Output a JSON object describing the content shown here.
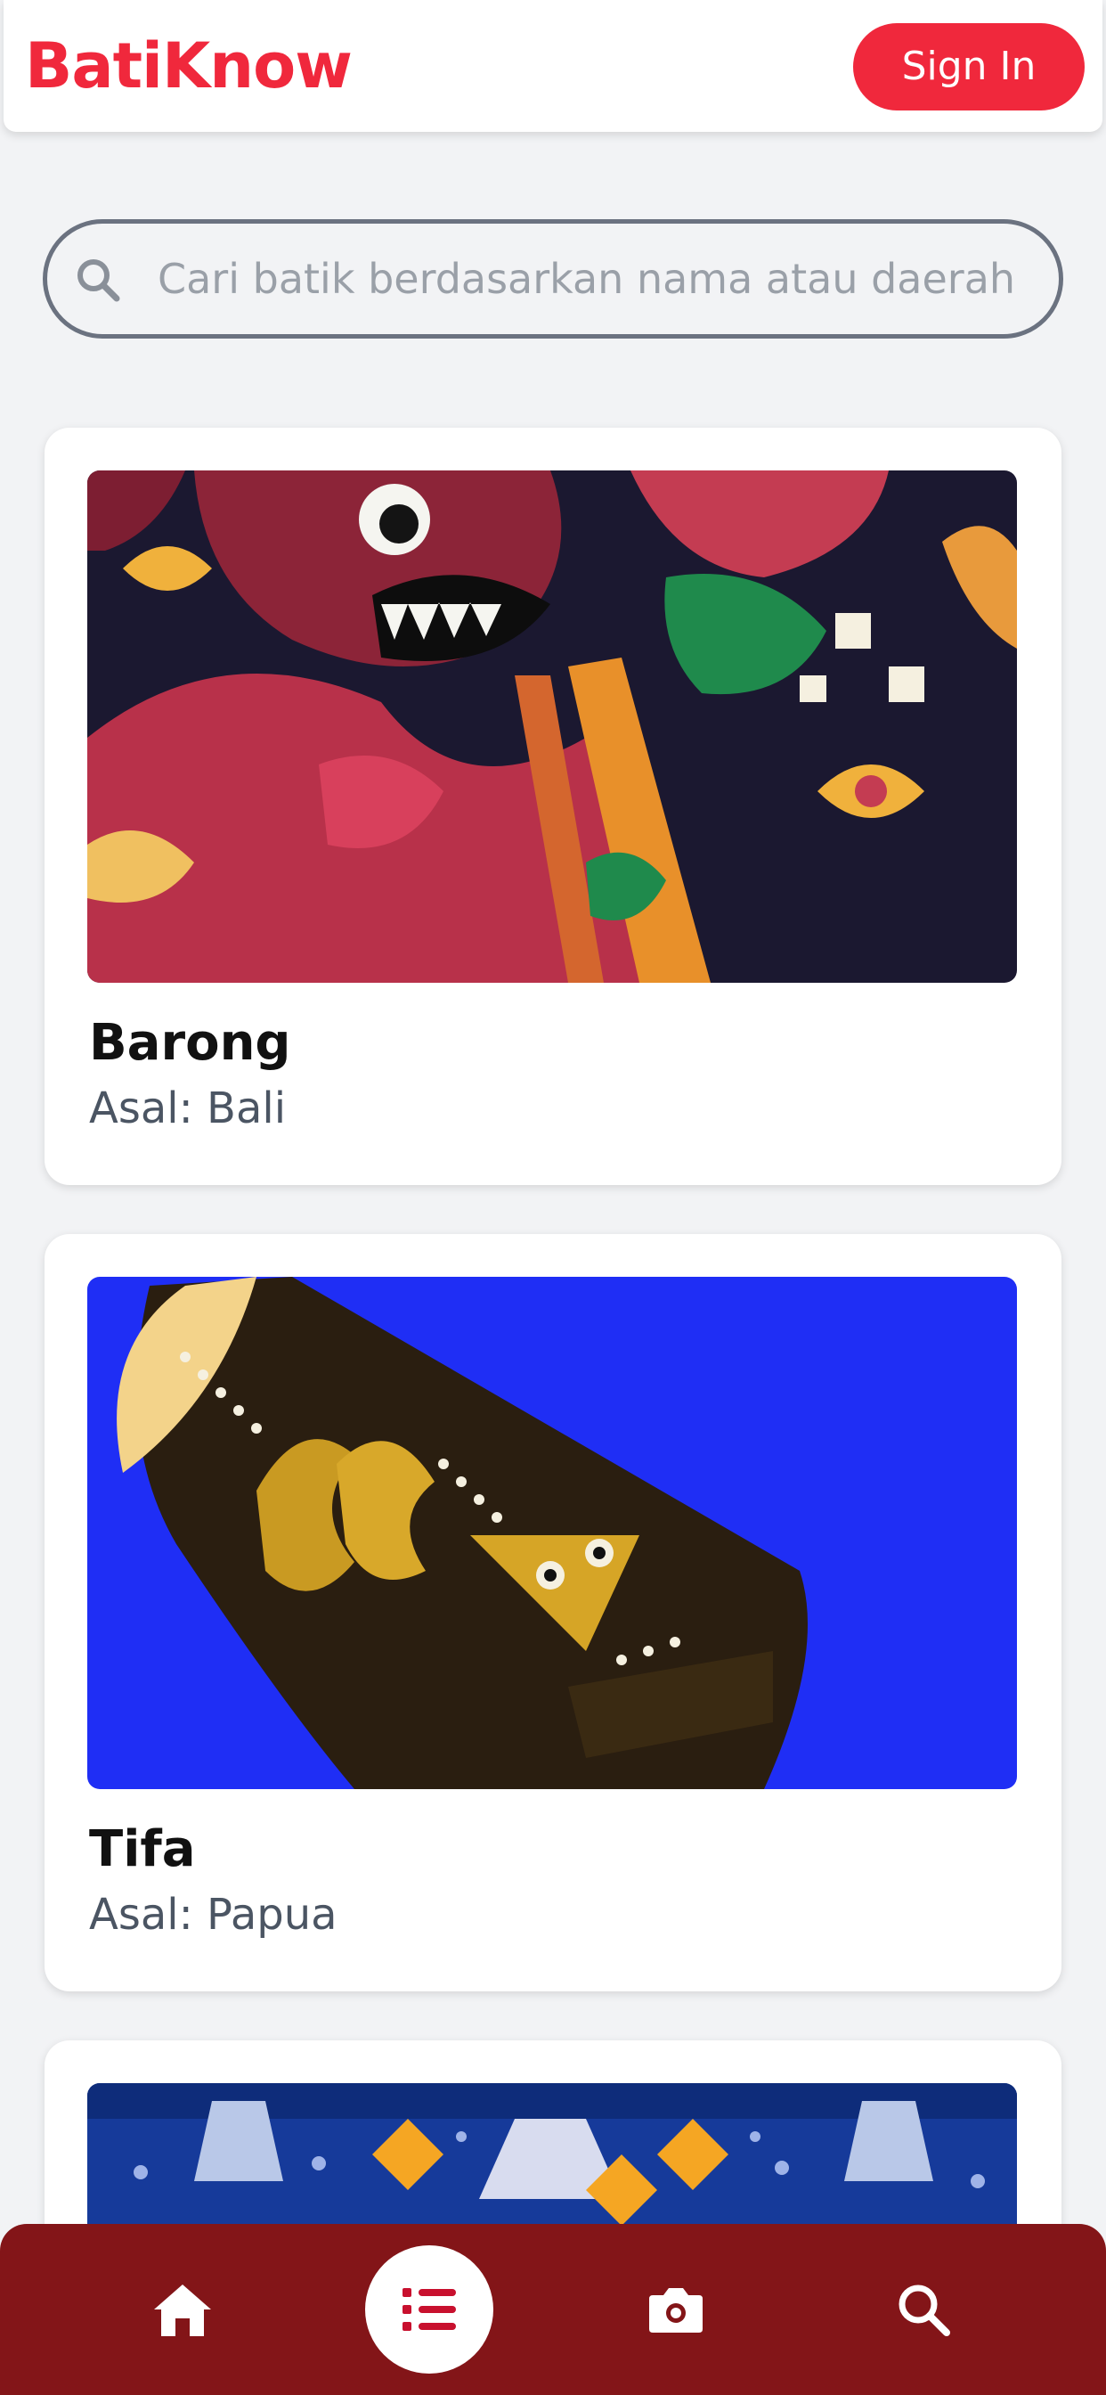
{
  "header": {
    "brand": "BatiKnow",
    "signin_label": "Sign In"
  },
  "search": {
    "placeholder": "Cari batik berdasarkan nama atau daerah"
  },
  "cards": [
    {
      "title": "Barong",
      "origin": "Asal: Bali"
    },
    {
      "title": "Tifa",
      "origin": "Asal: Papua"
    }
  ],
  "bottom_nav": {
    "items": [
      {
        "icon": "home-icon",
        "active": false
      },
      {
        "icon": "list-icon",
        "active": true
      },
      {
        "icon": "camera-icon",
        "active": false
      },
      {
        "icon": "search-icon",
        "active": false
      }
    ]
  },
  "colors": {
    "brand_red": "#f0283c",
    "nav_background": "#831518",
    "page_background": "#f2f3f5"
  }
}
